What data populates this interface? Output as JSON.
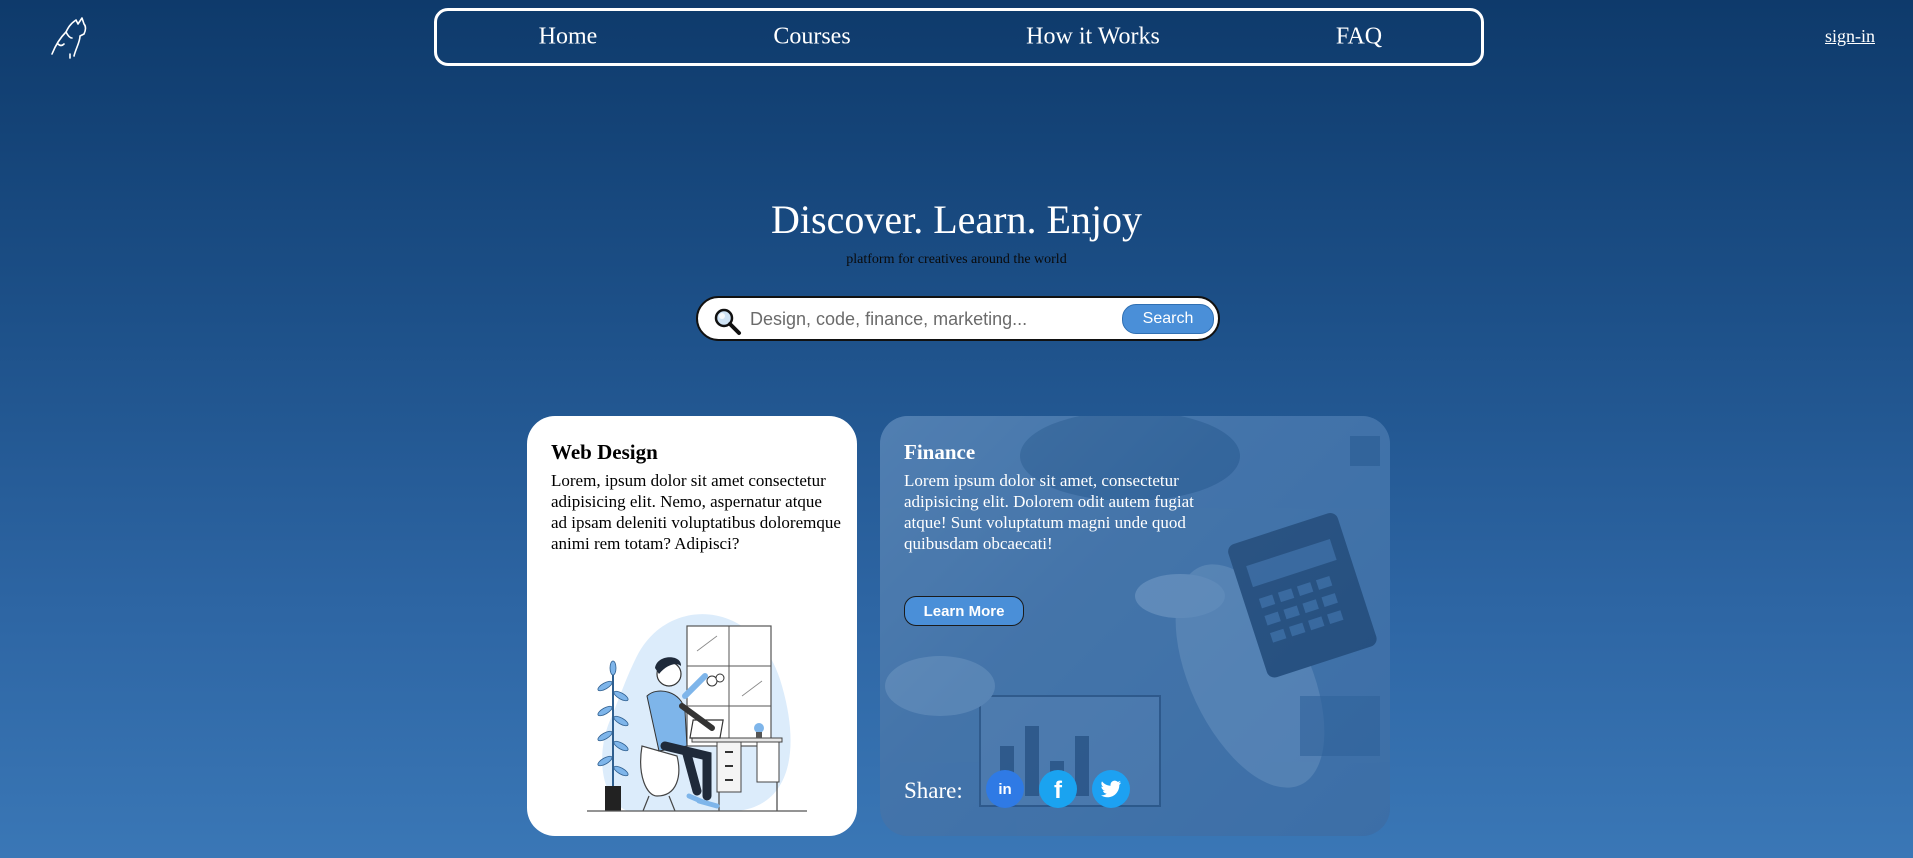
{
  "header": {
    "logo_icon": "wolf-howling-logo-icon",
    "nav": [
      {
        "label": "Home"
      },
      {
        "label": "Courses"
      },
      {
        "label": "How it Works"
      },
      {
        "label": "FAQ"
      }
    ],
    "signin_label": "sign-in"
  },
  "hero": {
    "title": "Discover. Learn. Enjoy",
    "subtitle": "platform for creatives around the world"
  },
  "search": {
    "placeholder": "Design, code, finance, marketing...",
    "value": "",
    "button_label": "Search",
    "icon": "magnifier-icon"
  },
  "cards": {
    "web_design": {
      "title": "Web Design",
      "body": "Lorem, ipsum dolor sit amet consectetur adipisicing elit. Nemo, aspernatur atque ad ipsam deleniti voluptatibus doloremque animi rem totam? Adipisci?"
    },
    "finance": {
      "title": "Finance",
      "body": "Lorem ipsum dolor sit amet, consectetur adipisicing elit. Dolorem odit autem fugiat atque! Sunt voluptatum magni unde quod quibusdam obcaecati!",
      "button_label": "Learn More",
      "share_label": "Share:",
      "social_icons": [
        "linkedin-icon",
        "facebook-icon",
        "twitter-icon"
      ]
    }
  },
  "colors": {
    "background_top": "#0e3a6b",
    "background_bottom": "#3a77b6",
    "accent_button": "#4a8fd8",
    "linkedin": "#2f7ae5",
    "facebook": "#1aa3f0",
    "twitter": "#1da1f2"
  }
}
